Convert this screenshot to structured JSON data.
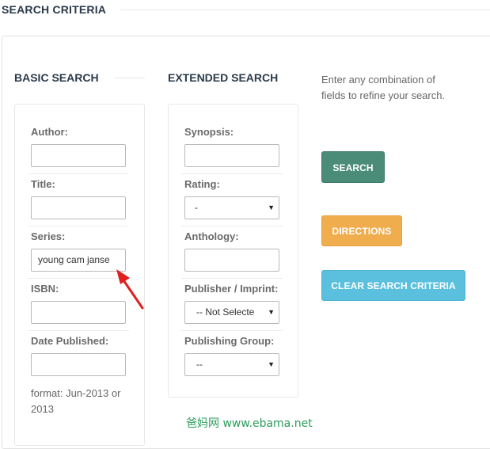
{
  "header": {
    "title": "SEARCH CRITERIA"
  },
  "basic": {
    "title": "BASIC SEARCH",
    "author": {
      "label": "Author:",
      "value": ""
    },
    "title_field": {
      "label": "Title:",
      "value": ""
    },
    "series": {
      "label": "Series:",
      "value": "young cam janse"
    },
    "isbn": {
      "label": "ISBN:",
      "value": ""
    },
    "date": {
      "label": "Date Published:",
      "value": ""
    },
    "format_hint": "format: Jun-2013 or 2013"
  },
  "extended": {
    "title": "EXTENDED SEARCH",
    "synopsis": {
      "label": "Synopsis:",
      "value": ""
    },
    "rating": {
      "label": "Rating:",
      "selected": "-"
    },
    "anthology": {
      "label": "Anthology:",
      "value": ""
    },
    "publisher": {
      "label": "Publisher / Imprint:",
      "selected": "-- Not Selecte"
    },
    "group": {
      "label": "Publishing Group:",
      "selected": "--"
    }
  },
  "help_text": "Enter any combination of fields to refine your search.",
  "buttons": {
    "search": "SEARCH",
    "directions": "DIRECTIONS",
    "clear": "CLEAR SEARCH CRITERIA"
  },
  "colors": {
    "search": "#4b8c79",
    "directions": "#f0ad4e",
    "clear": "#5bc0de",
    "arrow": "#e0201e"
  },
  "watermark": "爸妈网 www.ebama.net"
}
